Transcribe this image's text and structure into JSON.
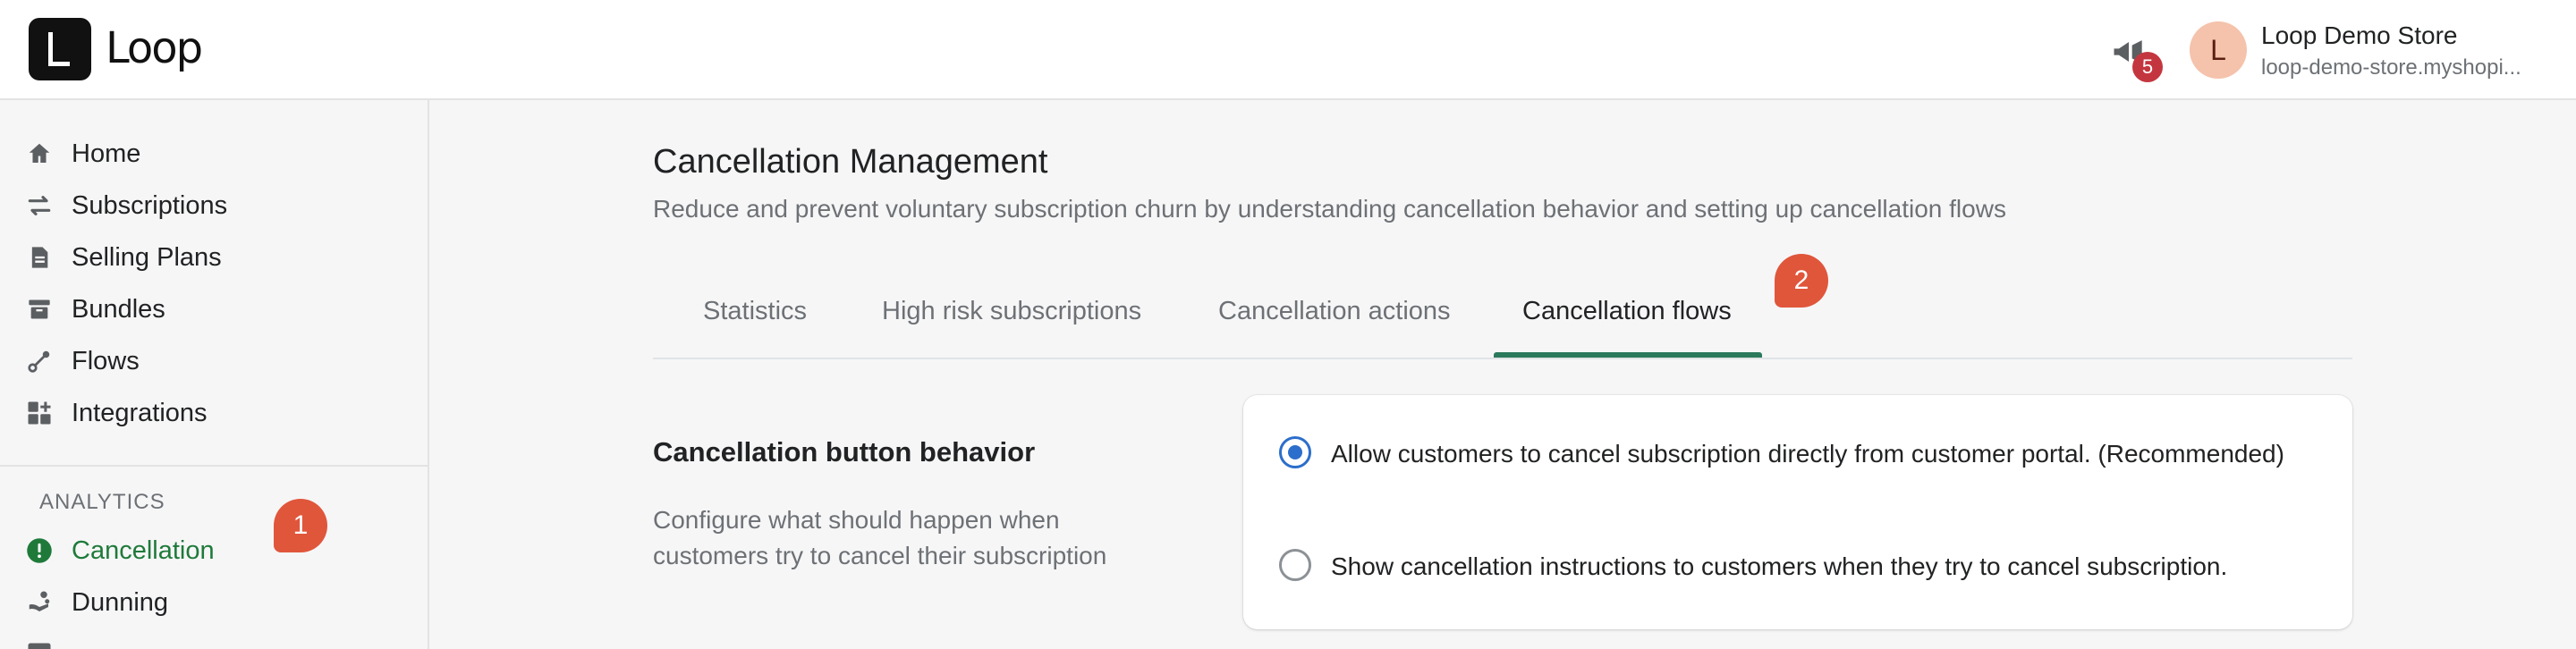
{
  "brand": {
    "logo_letter": "L",
    "name": "Loop"
  },
  "header": {
    "notifications_count": "5",
    "avatar_initial": "L",
    "store_name": "Loop Demo Store",
    "store_domain": "loop-demo-store.myshopi..."
  },
  "sidebar": {
    "items": [
      {
        "label": "Home",
        "icon": "home-icon"
      },
      {
        "label": "Subscriptions",
        "icon": "arrows-swap-icon"
      },
      {
        "label": "Selling Plans",
        "icon": "document-icon"
      },
      {
        "label": "Bundles",
        "icon": "archive-box-icon"
      },
      {
        "label": "Flows",
        "icon": "flow-icon"
      },
      {
        "label": "Integrations",
        "icon": "apps-grid-icon"
      }
    ],
    "analytics_title": "ANALYTICS",
    "analytics_items": [
      {
        "label": "Cancellation",
        "icon": "alert-circle-icon",
        "active": true
      },
      {
        "label": "Dunning",
        "icon": "dunning-icon"
      }
    ]
  },
  "annotations": {
    "step1": "1",
    "step2": "2"
  },
  "main": {
    "title": "Cancellation Management",
    "subtitle": "Reduce and prevent voluntary subscription churn by understanding cancellation behavior and setting up cancellation flows",
    "tabs": [
      {
        "label": "Statistics"
      },
      {
        "label": "High risk subscriptions"
      },
      {
        "label": "Cancellation actions"
      },
      {
        "label": "Cancellation flows",
        "active": true
      }
    ],
    "section": {
      "heading": "Cancellation button behavior",
      "description": "Configure what should happen when customers try to cancel their subscription",
      "options": [
        {
          "label": "Allow customers to cancel subscription directly from customer portal. (Recommended)",
          "checked": true
        },
        {
          "label": "Show cancellation instructions to customers when they try to cancel subscription.",
          "checked": false
        }
      ]
    }
  },
  "colors": {
    "accent_green": "#1f7a3a",
    "tab_underline": "#2b7a5c",
    "radio_blue": "#2c6ecb",
    "annotation": "#e0563b",
    "badge_red": "#c4363f"
  }
}
